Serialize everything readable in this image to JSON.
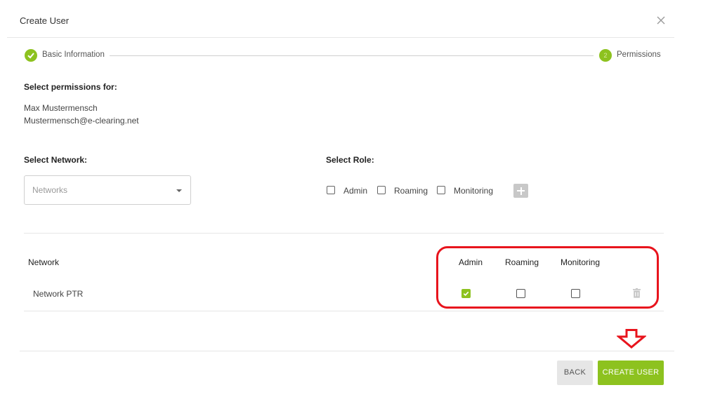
{
  "dialog": {
    "title": "Create User"
  },
  "stepper": {
    "steps": [
      {
        "label": "Basic Information",
        "state": "done"
      },
      {
        "number": "2",
        "label": "Permissions",
        "state": "active"
      }
    ]
  },
  "user": {
    "heading": "Select permissions for:",
    "name": "Max Mustermensch",
    "email": "Mustermensch@e-clearing.net"
  },
  "network_select": {
    "label": "Select Network:",
    "placeholder": "Networks"
  },
  "role_select": {
    "label": "Select Role:",
    "options": [
      {
        "label": "Admin",
        "checked": false
      },
      {
        "label": "Roaming",
        "checked": false
      },
      {
        "label": "Monitoring",
        "checked": false
      }
    ]
  },
  "table": {
    "headers": {
      "network": "Network",
      "admin": "Admin",
      "roaming": "Roaming",
      "monitoring": "Monitoring"
    },
    "rows": [
      {
        "network": "Network PTR",
        "admin": true,
        "roaming": false,
        "monitoring": false
      }
    ]
  },
  "footer": {
    "back_label": "BACK",
    "create_label": "CREATE USER"
  },
  "colors": {
    "accent": "#8dc21f",
    "annotation": "#e8141d"
  }
}
